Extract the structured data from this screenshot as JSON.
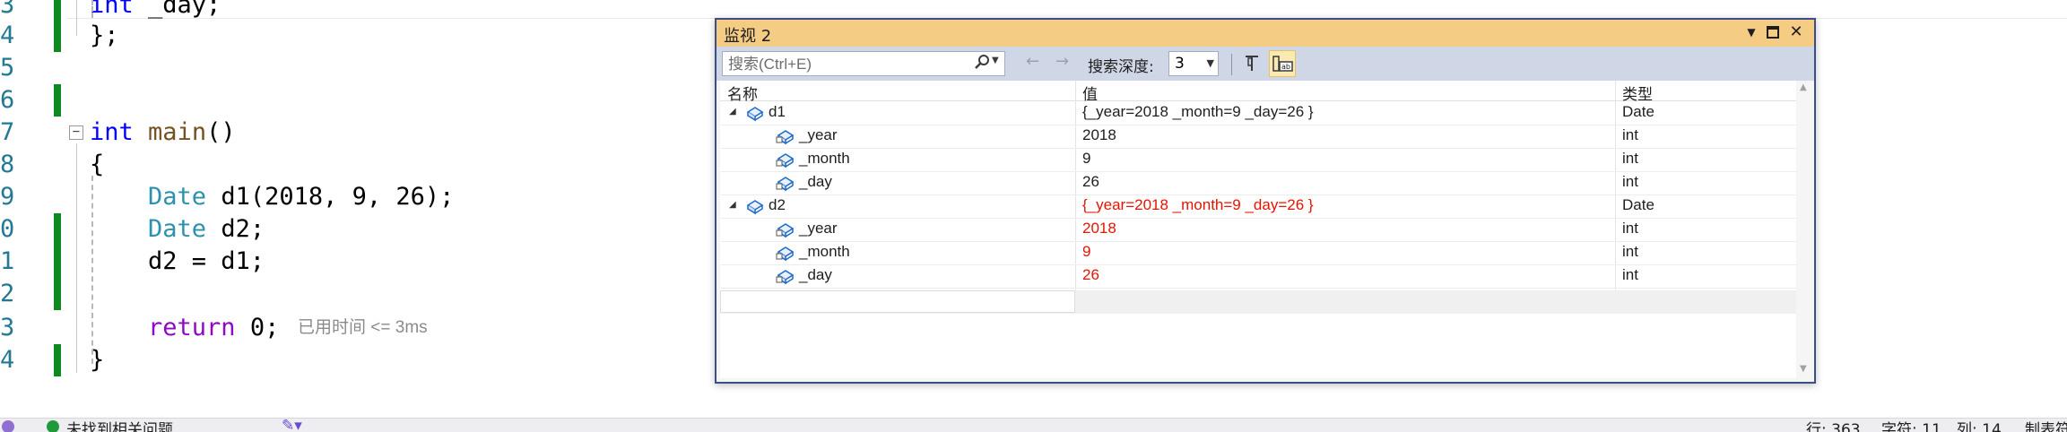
{
  "editor": {
    "lines": [
      {
        "number": "3",
        "code": "    int _day;"
      },
      {
        "number": "4",
        "code": "};"
      },
      {
        "number": "5",
        "code": ""
      },
      {
        "number": "6",
        "code": ""
      },
      {
        "number": "7",
        "code": "int main()"
      },
      {
        "number": "8",
        "code": "{"
      },
      {
        "number": "9",
        "code": "    Date d1(2018, 9, 26);"
      },
      {
        "number": "0",
        "code": "    Date d2;"
      },
      {
        "number": "1",
        "code": "    d2 = d1;"
      },
      {
        "number": "2",
        "code": ""
      },
      {
        "number": "3",
        "code": "    return 0;"
      },
      {
        "number": "4",
        "code": "}"
      }
    ],
    "elapsed_hint": "已用时间 <= 3ms"
  },
  "watch": {
    "title": "监视 2",
    "search_placeholder": "搜索(Ctrl+E)",
    "depth_label": "搜索深度:",
    "depth_value": "3",
    "columns": {
      "name": "名称",
      "value": "值",
      "type": "类型"
    },
    "rows": [
      {
        "name": "d1",
        "value": "{_year=2018 _month=9 _day=26 }",
        "type": "Date",
        "level": 0,
        "expanded": true,
        "changed": false
      },
      {
        "name": "_year",
        "value": "2018",
        "type": "int",
        "level": 1,
        "changed": false
      },
      {
        "name": "_month",
        "value": "9",
        "type": "int",
        "level": 1,
        "changed": false
      },
      {
        "name": "_day",
        "value": "26",
        "type": "int",
        "level": 1,
        "changed": false
      },
      {
        "name": "d2",
        "value": "{_year=2018 _month=9 _day=26 }",
        "type": "Date",
        "level": 0,
        "expanded": true,
        "changed": true
      },
      {
        "name": "_year",
        "value": "2018",
        "type": "int",
        "level": 1,
        "changed": true
      },
      {
        "name": "_month",
        "value": "9",
        "type": "int",
        "level": 1,
        "changed": true
      },
      {
        "name": "_day",
        "value": "26",
        "type": "int",
        "level": 1,
        "changed": true
      }
    ],
    "icons": {
      "pin": "pin-icon",
      "hex": "hex-display-icon",
      "search": "search-icon",
      "back": "back-arrow-icon",
      "forward": "forward-arrow-icon"
    },
    "colors": {
      "title_bar": "#f5cc84",
      "changed_value": "#e51400",
      "border": "#3c4e86"
    }
  },
  "statusbar": {
    "issues": "未找到相关问题",
    "line": "行: 363",
    "char": "字符: 11",
    "col": "列: 14",
    "tab": "制表符"
  },
  "colors": {
    "change_bar": "#108a1f",
    "keyword": "#0000ff",
    "type": "#2b91af"
  }
}
